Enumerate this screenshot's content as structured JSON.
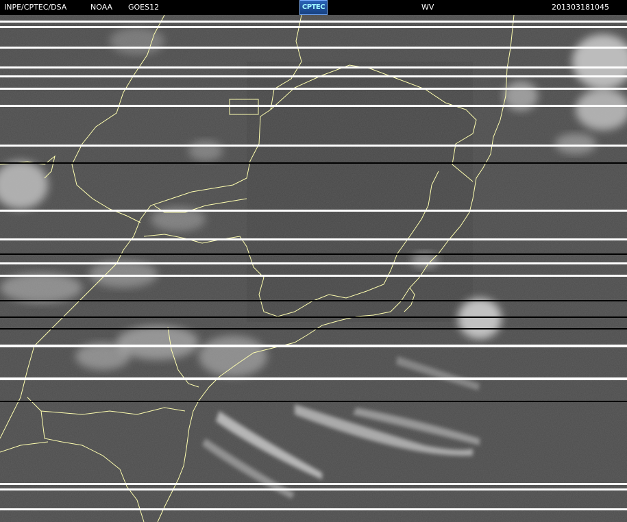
{
  "header": {
    "agency": "INPE/CPTEC/DSA",
    "source": "NOAA",
    "satellite": "GOES12",
    "logo_text": "CPTEC",
    "band": "WV",
    "timestamp": "201303181045"
  },
  "colors": {
    "background": "#4d4d4d",
    "cloud": "#dcdcdc",
    "coastline": "#ffffb0",
    "header_bg": "#000000",
    "header_text": "#ffffff"
  }
}
